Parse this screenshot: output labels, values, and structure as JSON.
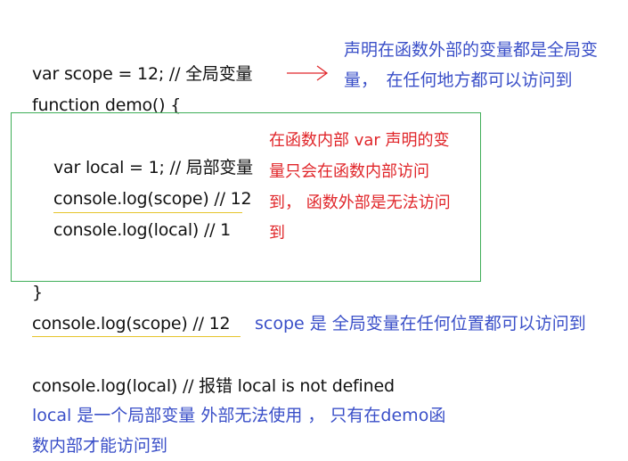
{
  "code": {
    "line_var_scope": "var scope = 12; // 全局变量",
    "line_function_demo": "function demo() {",
    "line_var_local": "var local = 1; // 局部变量",
    "line_log_scope_inner": "console.log(scope) // 12",
    "line_log_local_inner": "console.log(local) // 1",
    "line_close_brace": "}",
    "line_log_scope_outer": "console.log(scope) // 12",
    "line_log_local_outer": "console.log(local) // 报错 local is not defined"
  },
  "annotations": {
    "global_note_line1": "声明在函数外部的变量都是全局变",
    "global_note_line2": "量，　在任何地方都可以访问到",
    "local_note_line1": "在函数内部 var  声明的变",
    "local_note_line2": "量只会在函数内部访问",
    "local_note_line3": "到，  函数外部是无法访问",
    "local_note_line4": "到",
    "scope_note": "scope 是 全局变量在任何位置都可以访问到",
    "local_outside_note_line1": "local  是一个局部变量 外部无法使用  ， 只有在demo函",
    "local_outside_note_line2": "数内部才能访问到"
  },
  "colors": {
    "code_text": "#111111",
    "annotation_blue": "#3a4fc8",
    "annotation_red": "#e0262a",
    "box_border": "#3fae58",
    "underline": "#e6c52c",
    "arrow": "#e0262a"
  }
}
